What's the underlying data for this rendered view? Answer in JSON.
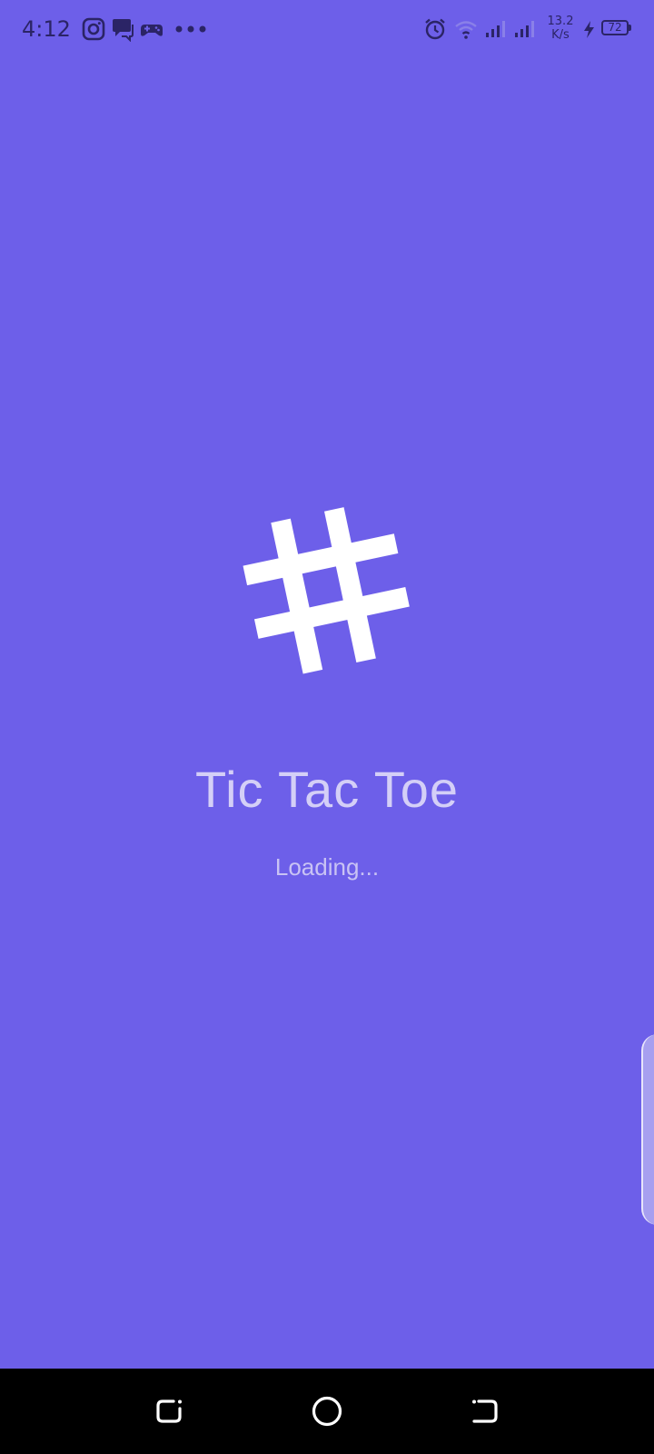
{
  "status_bar": {
    "time": "4:12",
    "network_speed_value": "13.2",
    "network_speed_unit": "K/s",
    "battery_level": "72",
    "icons": [
      "instagram-icon",
      "chat-icon",
      "gamepad-icon",
      "more-dots-icon",
      "alarm-icon",
      "wifi-icon",
      "signal-icon",
      "signal-icon",
      "charging-icon"
    ]
  },
  "app": {
    "title": "Tic Tac Toe",
    "loading_text": "Loading...",
    "logo_icon": "hash-grid-icon",
    "background_color": "#6d5fe9",
    "title_color": "#d4cff7"
  },
  "nav_bar": {
    "buttons": [
      "recents-button",
      "home-button",
      "back-button"
    ]
  }
}
